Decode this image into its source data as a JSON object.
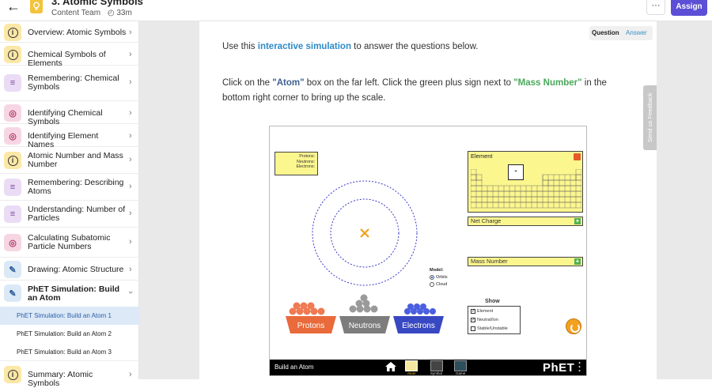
{
  "header": {
    "title": "3. Atomic Symbols",
    "team": "Content Team",
    "duration": "33m",
    "more_label": "···",
    "assign_label": "Assign"
  },
  "sidebar": {
    "items": [
      {
        "label": "Overview: Atomic Symbols",
        "icon": "info-icon"
      },
      {
        "label": "Chemical Symbols of Elements",
        "icon": "info-icon"
      },
      {
        "label": "Remembering: Chemical Symbols",
        "icon": "checklist-icon"
      },
      {
        "label": "Identifying Chemical Symbols",
        "icon": "target-icon"
      },
      {
        "label": "Identifying Element Names",
        "icon": "target-icon"
      },
      {
        "label": "Atomic Number and Mass Number",
        "icon": "info-icon"
      },
      {
        "label": "Remembering: Describing Atoms",
        "icon": "checklist-icon"
      },
      {
        "label": "Understanding: Number of Particles",
        "icon": "checklist-icon"
      },
      {
        "label": "Calculating Subatomic Particle Numbers",
        "icon": "target-icon"
      },
      {
        "label": "Drawing: Atomic Structure",
        "icon": "pencil-icon"
      },
      {
        "label": "PhET Simulation: Build an Atom",
        "icon": "pencil-icon"
      }
    ],
    "sub_items": [
      {
        "label": "PhET Simulation: Build an Atom 1",
        "active": true
      },
      {
        "label": "PhET Simulation: Build an Atom 2",
        "active": false
      },
      {
        "label": "PhET Simulation: Build an Atom 3",
        "active": false
      }
    ],
    "last_item": {
      "label": "Summary: Atomic Symbols",
      "icon": "info-icon"
    }
  },
  "main": {
    "toggle_question": "Question",
    "toggle_answer": "Answer",
    "p1_pre": "Use this ",
    "p1_link": "interactive simulation",
    "p1_post": " to answer the questions below.",
    "p2_a": "Click on the ",
    "p2_atom": "\"Atom\"",
    "p2_b": " box on the far left. Click the green plus sign next to ",
    "p2_mass": "\"Mass Number\"",
    "p2_c": " in the bottom right corner to bring up the scale.",
    "feedback": "Send us Feedback"
  },
  "sim": {
    "counts": [
      "Protons:",
      "Neutrons:",
      "Electrons:"
    ],
    "element_title": "Element",
    "element_symbol": "-",
    "net_charge": "Net Charge",
    "mass_number": "Mass Number",
    "model_title": "Model:",
    "model_orbits": "Orbits",
    "model_cloud": "Cloud",
    "show_title": "Show",
    "show_items": [
      "Element",
      "Neutral/Ion",
      "Stable/Unstable"
    ],
    "buckets": [
      "Protons",
      "Neutrons",
      "Electrons"
    ],
    "footer_name": "Build an Atom",
    "screens": [
      "Atom",
      "Symbol",
      "Game"
    ],
    "logo": "PhET",
    "colors": {
      "proton": "#f07a52",
      "neutron": "#9a9a9a",
      "electron": "#4a5fe0",
      "nucleus_x": "#f2a118",
      "panel": "#fcf68f"
    }
  }
}
